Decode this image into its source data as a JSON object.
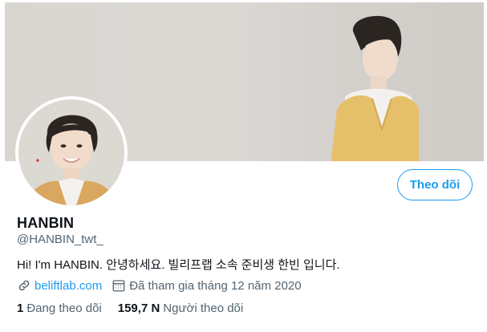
{
  "profile": {
    "display_name": "HANBIN",
    "handle": "@HANBIN_twt_",
    "bio": "Hi! I'm HANBIN. 안녕하세요. 빌리프랩 소속 준비생 한빈 입니다.",
    "website": "beliftlab.com",
    "joined": "Đã tham gia tháng 12 năm 2020",
    "follow_button": "Theo dõi"
  },
  "stats": {
    "following_count": "1",
    "following_label": "Đang theo dõi",
    "followers_count": "159,7 N",
    "followers_label": "Người theo dõi"
  },
  "icons": {
    "website": "link-icon",
    "joined": "calendar-icon"
  },
  "colors": {
    "accent": "#1d9bf0",
    "secondary_text": "#536471",
    "primary_text": "#0f1419"
  }
}
